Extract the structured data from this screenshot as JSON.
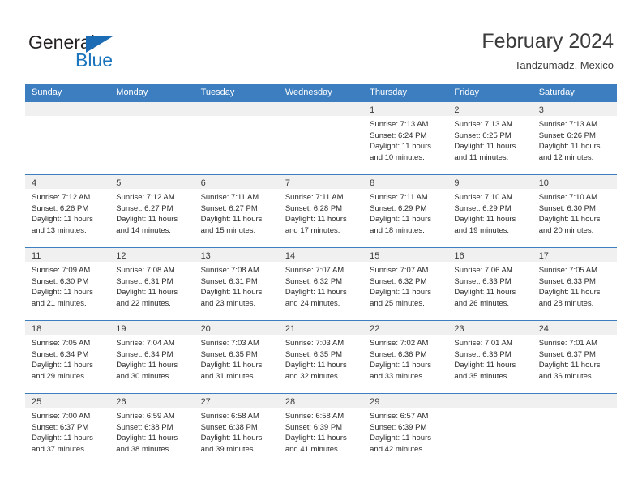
{
  "brand": {
    "name_top": "General",
    "name_bottom": "Blue",
    "triangle_icon": "triangle-icon",
    "accent_color": "#1b75bc",
    "header_color": "#3c7ebf"
  },
  "header": {
    "title": "February 2024",
    "subtitle": "Tandzumadz, Mexico"
  },
  "weekdays": [
    "Sunday",
    "Monday",
    "Tuesday",
    "Wednesday",
    "Thursday",
    "Friday",
    "Saturday"
  ],
  "weeks": [
    [
      {
        "day": "",
        "empty": true,
        "sunrise": "",
        "sunset": "",
        "daylight_l1": "",
        "daylight_l2": ""
      },
      {
        "day": "",
        "empty": true,
        "sunrise": "",
        "sunset": "",
        "daylight_l1": "",
        "daylight_l2": ""
      },
      {
        "day": "",
        "empty": true,
        "sunrise": "",
        "sunset": "",
        "daylight_l1": "",
        "daylight_l2": ""
      },
      {
        "day": "",
        "empty": true,
        "sunrise": "",
        "sunset": "",
        "daylight_l1": "",
        "daylight_l2": ""
      },
      {
        "day": "1",
        "empty": false,
        "sunrise": "Sunrise: 7:13 AM",
        "sunset": "Sunset: 6:24 PM",
        "daylight_l1": "Daylight: 11 hours",
        "daylight_l2": "and 10 minutes."
      },
      {
        "day": "2",
        "empty": false,
        "sunrise": "Sunrise: 7:13 AM",
        "sunset": "Sunset: 6:25 PM",
        "daylight_l1": "Daylight: 11 hours",
        "daylight_l2": "and 11 minutes."
      },
      {
        "day": "3",
        "empty": false,
        "sunrise": "Sunrise: 7:13 AM",
        "sunset": "Sunset: 6:26 PM",
        "daylight_l1": "Daylight: 11 hours",
        "daylight_l2": "and 12 minutes."
      }
    ],
    [
      {
        "day": "4",
        "empty": false,
        "sunrise": "Sunrise: 7:12 AM",
        "sunset": "Sunset: 6:26 PM",
        "daylight_l1": "Daylight: 11 hours",
        "daylight_l2": "and 13 minutes."
      },
      {
        "day": "5",
        "empty": false,
        "sunrise": "Sunrise: 7:12 AM",
        "sunset": "Sunset: 6:27 PM",
        "daylight_l1": "Daylight: 11 hours",
        "daylight_l2": "and 14 minutes."
      },
      {
        "day": "6",
        "empty": false,
        "sunrise": "Sunrise: 7:11 AM",
        "sunset": "Sunset: 6:27 PM",
        "daylight_l1": "Daylight: 11 hours",
        "daylight_l2": "and 15 minutes."
      },
      {
        "day": "7",
        "empty": false,
        "sunrise": "Sunrise: 7:11 AM",
        "sunset": "Sunset: 6:28 PM",
        "daylight_l1": "Daylight: 11 hours",
        "daylight_l2": "and 17 minutes."
      },
      {
        "day": "8",
        "empty": false,
        "sunrise": "Sunrise: 7:11 AM",
        "sunset": "Sunset: 6:29 PM",
        "daylight_l1": "Daylight: 11 hours",
        "daylight_l2": "and 18 minutes."
      },
      {
        "day": "9",
        "empty": false,
        "sunrise": "Sunrise: 7:10 AM",
        "sunset": "Sunset: 6:29 PM",
        "daylight_l1": "Daylight: 11 hours",
        "daylight_l2": "and 19 minutes."
      },
      {
        "day": "10",
        "empty": false,
        "sunrise": "Sunrise: 7:10 AM",
        "sunset": "Sunset: 6:30 PM",
        "daylight_l1": "Daylight: 11 hours",
        "daylight_l2": "and 20 minutes."
      }
    ],
    [
      {
        "day": "11",
        "empty": false,
        "sunrise": "Sunrise: 7:09 AM",
        "sunset": "Sunset: 6:30 PM",
        "daylight_l1": "Daylight: 11 hours",
        "daylight_l2": "and 21 minutes."
      },
      {
        "day": "12",
        "empty": false,
        "sunrise": "Sunrise: 7:08 AM",
        "sunset": "Sunset: 6:31 PM",
        "daylight_l1": "Daylight: 11 hours",
        "daylight_l2": "and 22 minutes."
      },
      {
        "day": "13",
        "empty": false,
        "sunrise": "Sunrise: 7:08 AM",
        "sunset": "Sunset: 6:31 PM",
        "daylight_l1": "Daylight: 11 hours",
        "daylight_l2": "and 23 minutes."
      },
      {
        "day": "14",
        "empty": false,
        "sunrise": "Sunrise: 7:07 AM",
        "sunset": "Sunset: 6:32 PM",
        "daylight_l1": "Daylight: 11 hours",
        "daylight_l2": "and 24 minutes."
      },
      {
        "day": "15",
        "empty": false,
        "sunrise": "Sunrise: 7:07 AM",
        "sunset": "Sunset: 6:32 PM",
        "daylight_l1": "Daylight: 11 hours",
        "daylight_l2": "and 25 minutes."
      },
      {
        "day": "16",
        "empty": false,
        "sunrise": "Sunrise: 7:06 AM",
        "sunset": "Sunset: 6:33 PM",
        "daylight_l1": "Daylight: 11 hours",
        "daylight_l2": "and 26 minutes."
      },
      {
        "day": "17",
        "empty": false,
        "sunrise": "Sunrise: 7:05 AM",
        "sunset": "Sunset: 6:33 PM",
        "daylight_l1": "Daylight: 11 hours",
        "daylight_l2": "and 28 minutes."
      }
    ],
    [
      {
        "day": "18",
        "empty": false,
        "sunrise": "Sunrise: 7:05 AM",
        "sunset": "Sunset: 6:34 PM",
        "daylight_l1": "Daylight: 11 hours",
        "daylight_l2": "and 29 minutes."
      },
      {
        "day": "19",
        "empty": false,
        "sunrise": "Sunrise: 7:04 AM",
        "sunset": "Sunset: 6:34 PM",
        "daylight_l1": "Daylight: 11 hours",
        "daylight_l2": "and 30 minutes."
      },
      {
        "day": "20",
        "empty": false,
        "sunrise": "Sunrise: 7:03 AM",
        "sunset": "Sunset: 6:35 PM",
        "daylight_l1": "Daylight: 11 hours",
        "daylight_l2": "and 31 minutes."
      },
      {
        "day": "21",
        "empty": false,
        "sunrise": "Sunrise: 7:03 AM",
        "sunset": "Sunset: 6:35 PM",
        "daylight_l1": "Daylight: 11 hours",
        "daylight_l2": "and 32 minutes."
      },
      {
        "day": "22",
        "empty": false,
        "sunrise": "Sunrise: 7:02 AM",
        "sunset": "Sunset: 6:36 PM",
        "daylight_l1": "Daylight: 11 hours",
        "daylight_l2": "and 33 minutes."
      },
      {
        "day": "23",
        "empty": false,
        "sunrise": "Sunrise: 7:01 AM",
        "sunset": "Sunset: 6:36 PM",
        "daylight_l1": "Daylight: 11 hours",
        "daylight_l2": "and 35 minutes."
      },
      {
        "day": "24",
        "empty": false,
        "sunrise": "Sunrise: 7:01 AM",
        "sunset": "Sunset: 6:37 PM",
        "daylight_l1": "Daylight: 11 hours",
        "daylight_l2": "and 36 minutes."
      }
    ],
    [
      {
        "day": "25",
        "empty": false,
        "sunrise": "Sunrise: 7:00 AM",
        "sunset": "Sunset: 6:37 PM",
        "daylight_l1": "Daylight: 11 hours",
        "daylight_l2": "and 37 minutes."
      },
      {
        "day": "26",
        "empty": false,
        "sunrise": "Sunrise: 6:59 AM",
        "sunset": "Sunset: 6:38 PM",
        "daylight_l1": "Daylight: 11 hours",
        "daylight_l2": "and 38 minutes."
      },
      {
        "day": "27",
        "empty": false,
        "sunrise": "Sunrise: 6:58 AM",
        "sunset": "Sunset: 6:38 PM",
        "daylight_l1": "Daylight: 11 hours",
        "daylight_l2": "and 39 minutes."
      },
      {
        "day": "28",
        "empty": false,
        "sunrise": "Sunrise: 6:58 AM",
        "sunset": "Sunset: 6:39 PM",
        "daylight_l1": "Daylight: 11 hours",
        "daylight_l2": "and 41 minutes."
      },
      {
        "day": "29",
        "empty": false,
        "sunrise": "Sunrise: 6:57 AM",
        "sunset": "Sunset: 6:39 PM",
        "daylight_l1": "Daylight: 11 hours",
        "daylight_l2": "and 42 minutes."
      },
      {
        "day": "",
        "empty": true,
        "sunrise": "",
        "sunset": "",
        "daylight_l1": "",
        "daylight_l2": ""
      },
      {
        "day": "",
        "empty": true,
        "sunrise": "",
        "sunset": "",
        "daylight_l1": "",
        "daylight_l2": ""
      }
    ]
  ]
}
